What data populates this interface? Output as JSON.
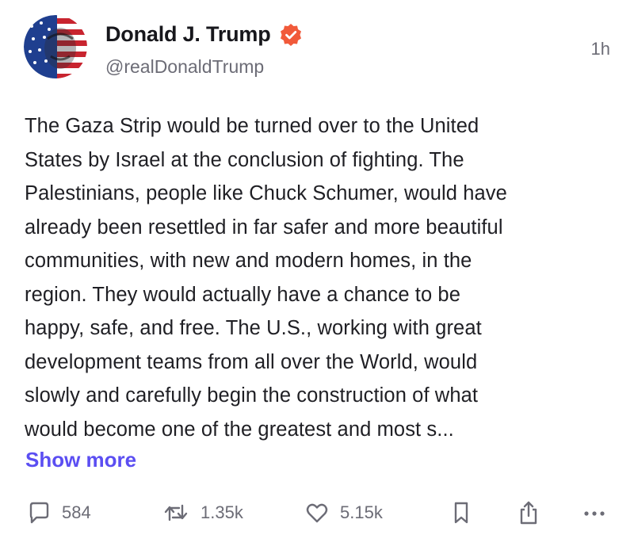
{
  "post": {
    "author": {
      "display_name": "Donald J. Trump",
      "handle": "@realDonaldTrump",
      "verified": true,
      "verified_color": "#f15a3a"
    },
    "timestamp": "1h",
    "body": "The Gaza Strip would be turned over to the United\nStates by Israel at the conclusion of fighting. The\nPalestinians, people like Chuck Schumer, would have\nalready been resettled in far safer and more beautiful\ncommunities, with new and modern homes, in the\nregion. They would actually have a chance to be\nhappy, safe, and free. The U.S., working with great\ndevelopment teams from all over the World, would\nslowly and carefully begin the construction of what\nwould become one of the greatest and most s...",
    "show_more_label": "Show more",
    "accent_color": "#5b4ef2"
  },
  "actions": {
    "reply": {
      "icon": "comment-icon",
      "count": "584"
    },
    "retruth": {
      "icon": "retruth-icon",
      "count": "1.35k"
    },
    "like": {
      "icon": "heart-icon",
      "count": "5.15k"
    },
    "bookmark": {
      "icon": "bookmark-icon"
    },
    "share": {
      "icon": "share-icon"
    },
    "more": {
      "icon": "more-icon"
    }
  }
}
